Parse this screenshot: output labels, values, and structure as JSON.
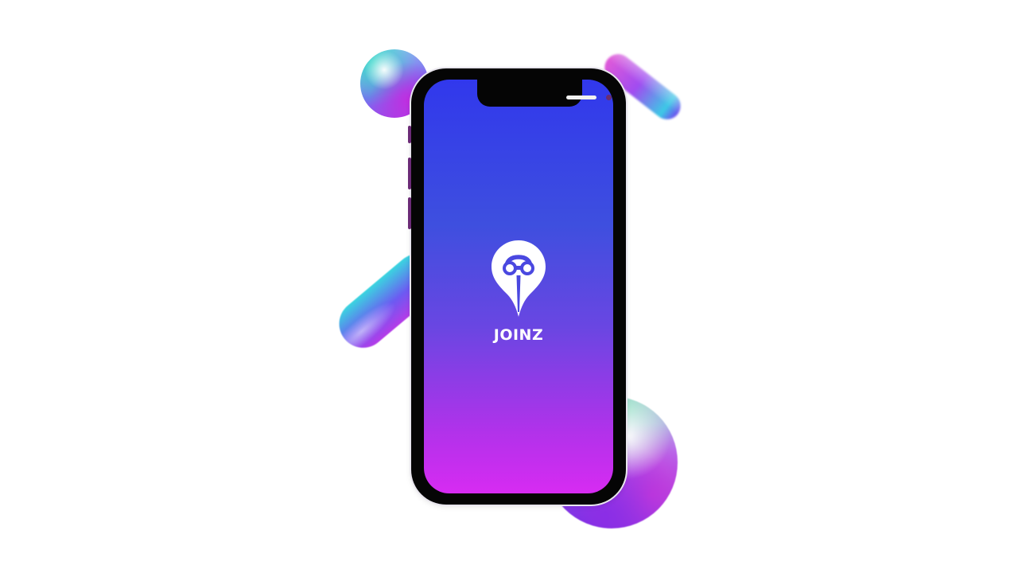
{
  "app": {
    "brand_name": "JOINZ",
    "logo_icon": "location-pin-icon"
  },
  "colors": {
    "screen_gradient_top": "#3138ec",
    "screen_gradient_bottom": "#d72bf2",
    "logo_color": "#ffffff",
    "phone_body": "#050505"
  }
}
